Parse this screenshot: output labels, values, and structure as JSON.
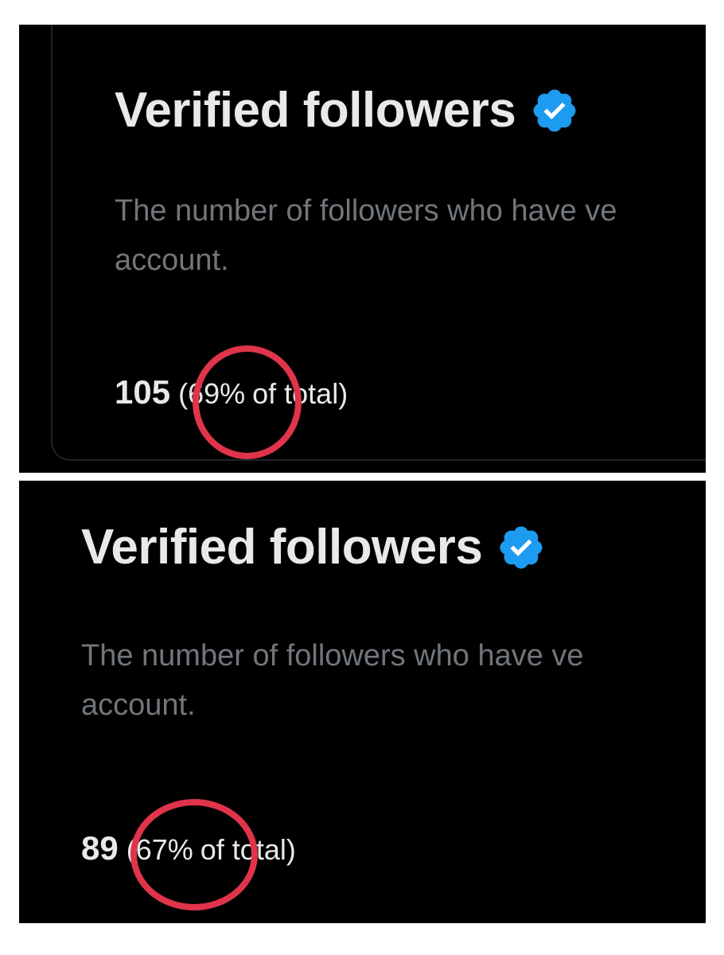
{
  "panels": [
    {
      "title": "Verified followers",
      "description_line1": "The number of followers who have ve",
      "description_line2": "account.",
      "count": "105",
      "percent": "(69%",
      "suffix": "of total)"
    },
    {
      "title": "Verified followers",
      "description_line1": "The number of followers who have ve",
      "description_line2": "account.",
      "count": "89",
      "percent": "(67%",
      "suffix": "of total)"
    }
  ],
  "colors": {
    "background": "#000000",
    "title_text": "#e7e9ea",
    "description_text": "#71767b",
    "verified_badge": "#1d9bf0",
    "highlight_ring": "#e0344b"
  },
  "icons": {
    "badge": "verified-badge-icon"
  }
}
